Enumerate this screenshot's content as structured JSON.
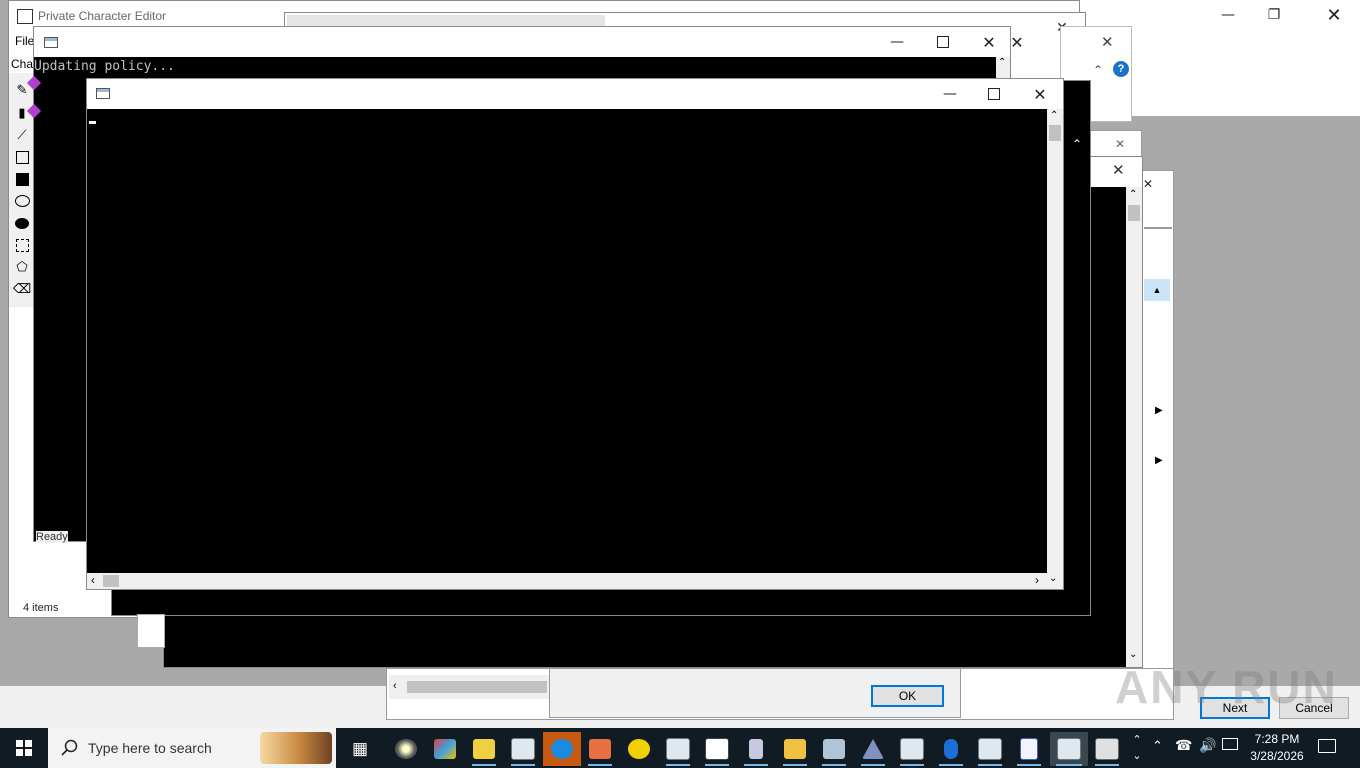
{
  "pce": {
    "title": "Private Character Editor",
    "menu_file": "File",
    "menu_char": "Cha",
    "status_items": "4 items",
    "status_ready": "Ready"
  },
  "policy_console": {
    "text": "Updating policy..."
  },
  "dialog": {
    "ok_label": "OK",
    "next_label": "Next",
    "cancel_label": "Cancel"
  },
  "taskbar": {
    "search_placeholder": "Type here to search",
    "time": "7:28 PM",
    "date": "3/28/2026"
  },
  "watermark": "ANY RUN",
  "colors": {
    "desktop": "#a9a9a9",
    "taskbar": "#101b24",
    "accent": "#0078d7"
  },
  "icons": {
    "start": "windows-logo-icon",
    "search": "search-icon",
    "task_view": "task-view-icon",
    "help": "help-icon"
  }
}
